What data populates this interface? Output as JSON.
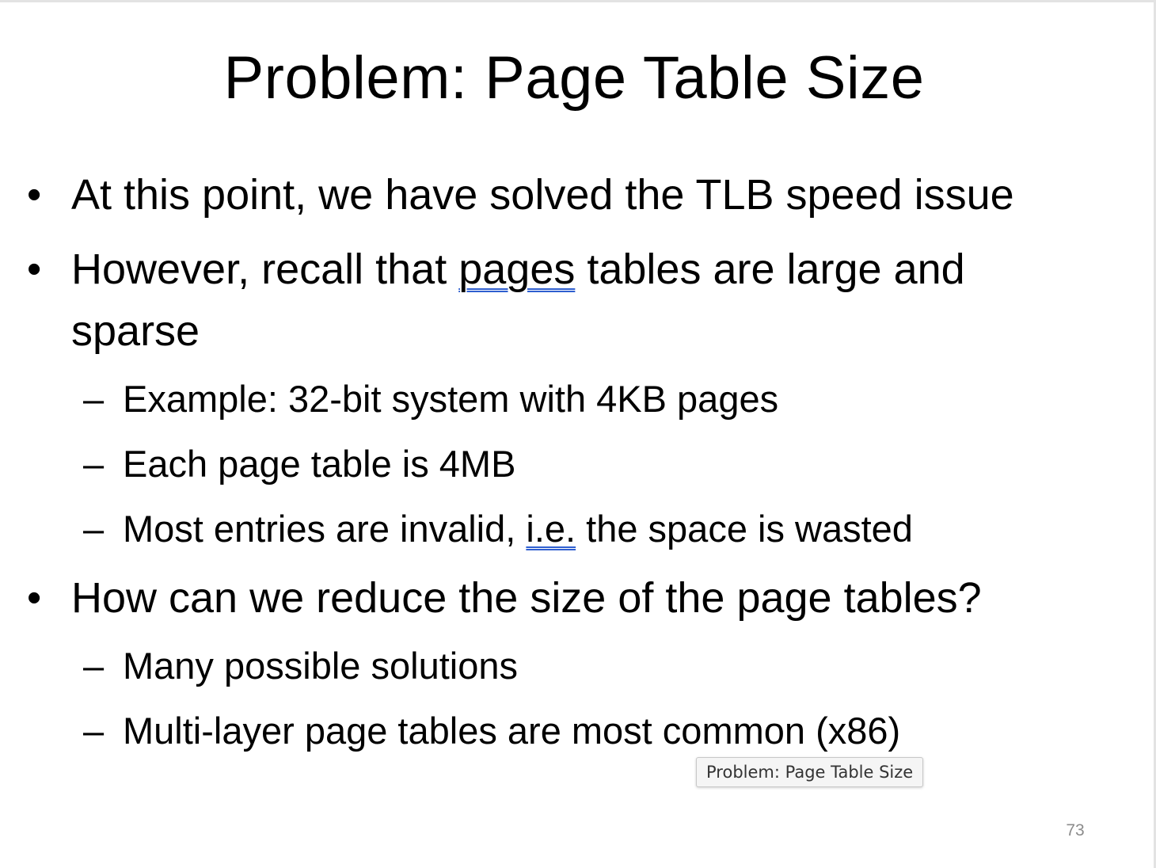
{
  "slide": {
    "title": "Problem: Page Table Size",
    "bullets": [
      {
        "text": "At this point, we have solved the TLB speed issue"
      },
      {
        "text_before": "However, recall that ",
        "link_text": "pages",
        "text_after": " tables are large and",
        "continuation": "sparse"
      },
      {
        "text": "How can we reduce the size of the page tables?"
      }
    ],
    "sub_bullets": [
      {
        "dash": "–",
        "text": "Example: 32-bit system with 4KB pages"
      },
      {
        "dash": "–",
        "text": "Each page table is 4MB"
      },
      {
        "dash": "–",
        "text_before": "Most entries are invalid, ",
        "link_text": "i.e.",
        "text_after": " the space is wasted"
      },
      {
        "dash": "–",
        "text": "Many possible solutions"
      },
      {
        "dash": "–",
        "text": "Multi-layer page tables are most common (x86)"
      }
    ],
    "page_number": "73"
  },
  "tooltip": {
    "text": "Problem: Page Table Size"
  },
  "colors": {
    "text": "#000000",
    "spellcheck_underline": "#2f5fd0",
    "page_number": "#8c8c8c",
    "tooltip_bg": "#f5f5f5"
  }
}
